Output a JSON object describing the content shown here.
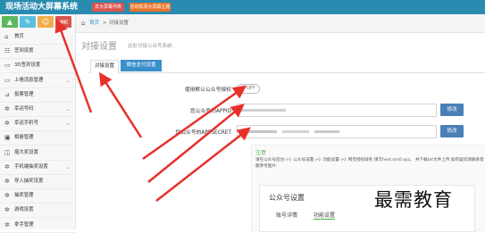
{
  "app": {
    "title": "现场活动大屏幕系统",
    "top_buttons": [
      "去大屏幕列表",
      "活动现场大屏幕主题"
    ]
  },
  "sidebar": {
    "icon_buttons": [
      {
        "icon": "stats-icon",
        "glyph": "▲",
        "color": "#5cb85c"
      },
      {
        "icon": "edit-icon",
        "glyph": "✎",
        "color": "#5bc0de"
      },
      {
        "icon": "user-icon",
        "glyph": "☺",
        "color": "#f0ad4e"
      },
      {
        "icon": "share-icon",
        "glyph": "⋘",
        "color": "#d9534f"
      }
    ],
    "items": [
      {
        "label": "首页",
        "icon": "home-icon",
        "glyph": "⌂",
        "chevron": false
      },
      {
        "label": "签到设置",
        "icon": "users-icon",
        "glyph": "☷",
        "chevron": true
      },
      {
        "label": "3D签到设置",
        "icon": "monitor-icon",
        "glyph": "▭",
        "chevron": false
      },
      {
        "label": "上墙消息管理",
        "icon": "monitor-icon",
        "glyph": "▭",
        "chevron": true
      },
      {
        "label": "投票管理",
        "icon": "chart-icon",
        "glyph": "⊿",
        "chevron": false
      },
      {
        "label": "幸运号码",
        "icon": "gear-icon",
        "glyph": "✲",
        "chevron": true
      },
      {
        "label": "幸运手机号",
        "icon": "gear-icon",
        "glyph": "✲",
        "chevron": true
      },
      {
        "label": "相册管理",
        "icon": "image-icon",
        "glyph": "▣",
        "chevron": false
      },
      {
        "label": "摇大奖设置",
        "icon": "gift-icon",
        "glyph": "◫",
        "chevron": false
      },
      {
        "label": "手机端抽奖设置",
        "icon": "gear-icon",
        "glyph": "✲",
        "chevron": true
      },
      {
        "label": "导入抽奖设置",
        "icon": "gear-icon",
        "glyph": "✲",
        "chevron": false
      },
      {
        "label": "抽奖管理",
        "icon": "gear-icon",
        "glyph": "✲",
        "chevron": false
      },
      {
        "label": "游戏设置",
        "icon": "gear-icon",
        "glyph": "✲",
        "chevron": false
      },
      {
        "label": "拿手管理",
        "icon": "gear-icon",
        "glyph": "✲",
        "chevron": false
      }
    ]
  },
  "breadcrumb": {
    "home": "首页",
    "separator": ">",
    "current": "对接设置"
  },
  "page": {
    "title": "对接设置",
    "subtitle": "此处对接公众号系统"
  },
  "tabs": [
    {
      "label": "对接设置",
      "active": true
    },
    {
      "label": "微信支付设置",
      "active": false
    }
  ],
  "form": {
    "toggle_label": "使用默认公众号授权",
    "toggle_state_label": "OFF",
    "appid_label": "您公众号的APPID",
    "appsecret_label": "您公众号的APPSECRET",
    "modify_button": "修改"
  },
  "note": {
    "title": "注意",
    "body": "请在公众号后台->》公众号设置->》功能设置->》网页授权域名 填写hest.om0.xyz。 并下载txt文件上传,如有疑问请联系客服参考图片:",
    "card_title": "公众号设置",
    "card_tabs": [
      "账号详情",
      "功能设置"
    ]
  },
  "watermark": "最需教育",
  "colors": {
    "topbar": "#2a8bb0",
    "accent_red": "#d9534f",
    "tab_blue": "#3a8fcb",
    "modify_button": "#4b7fb8",
    "arrow": "#e8302b"
  }
}
